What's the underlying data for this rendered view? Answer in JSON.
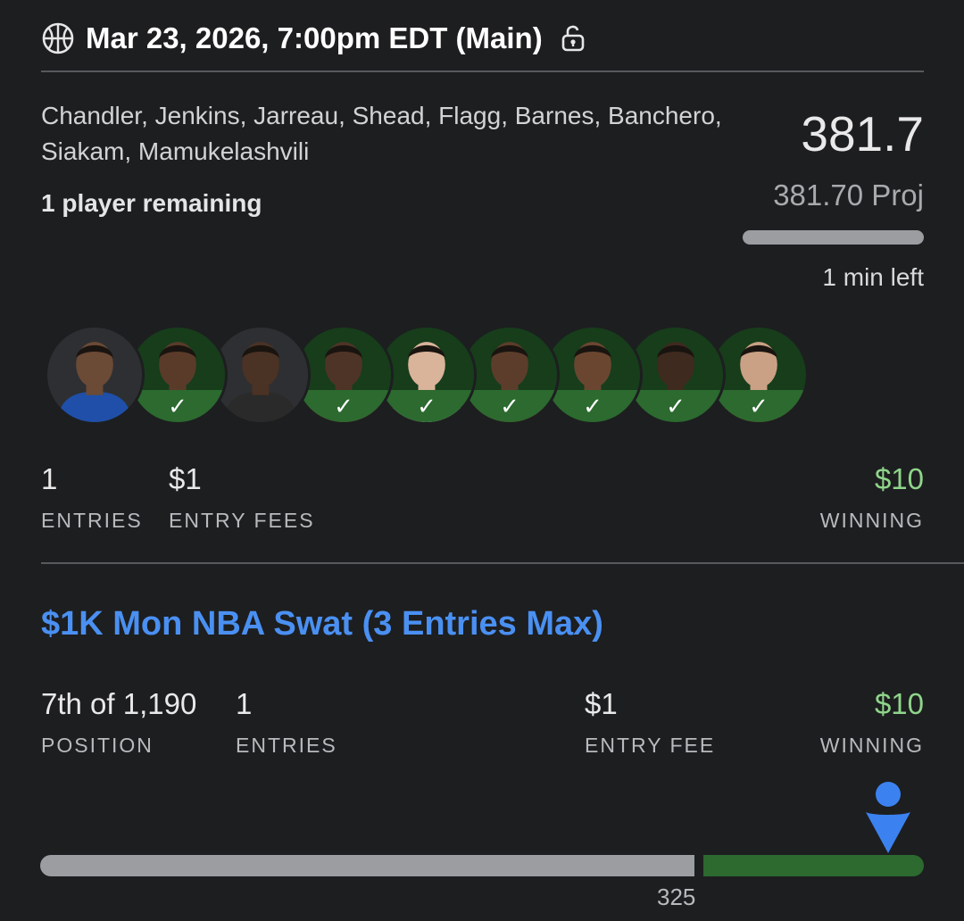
{
  "header": {
    "title": "Mar 23, 2026, 7:00pm EDT (Main)",
    "sport_icon": "basketball-icon",
    "lock_icon": "unlock-icon"
  },
  "lineup": {
    "players": "Chandler, Jenkins, Jarreau, Shead, Flagg, Barnes, Banchero, Siakam, Mamukelashvili",
    "remaining": "1 player remaining",
    "score": "381.7",
    "projection": "381.70 Proj",
    "time_left": "1 min left"
  },
  "roster": [
    {
      "completed": false
    },
    {
      "completed": true
    },
    {
      "completed": false
    },
    {
      "completed": true
    },
    {
      "completed": true
    },
    {
      "completed": true
    },
    {
      "completed": true
    },
    {
      "completed": true
    },
    {
      "completed": true
    }
  ],
  "summary": {
    "entries_value": "1",
    "entries_label": "ENTRIES",
    "fees_value": "$1",
    "fees_label": "ENTRY FEES",
    "winning_value": "$10",
    "winning_label": "WINNING"
  },
  "contest": {
    "name": "$1K Mon NBA Swat (3 Entries Max)",
    "position_value": "7th of 1,190",
    "position_label": "POSITION",
    "entries_value": "1",
    "entries_label": "ENTRIES",
    "fee_value": "$1",
    "fee_label": "ENTRY FEE",
    "winning_value": "$10",
    "winning_label": "WINNING",
    "cut_line": "325",
    "checkmark": "✓"
  },
  "colors": {
    "accent": "#4a90f2",
    "winning": "#8fd58a",
    "in_the_money": "#2c6a2f",
    "background": "#1d1e20"
  }
}
